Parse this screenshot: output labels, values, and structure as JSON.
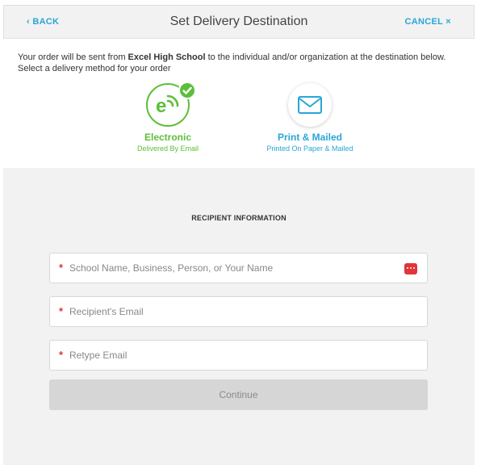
{
  "header": {
    "back_label": "‹ BACK",
    "title": "Set Delivery Destination",
    "cancel_label": "CANCEL ×"
  },
  "intro": {
    "prefix": "Your order will be sent from ",
    "school": "Excel High School",
    "suffix": " to the individual and/or organization at the destination below. Select a delivery method for your order"
  },
  "delivery_methods": [
    {
      "label": "Electronic",
      "sublabel": "Delivered By Email",
      "selected": true,
      "icon": "e-delivery-icon",
      "color": "#5cbf3a"
    },
    {
      "label": "Print & Mailed",
      "sublabel": "Printed On Paper & Mailed",
      "selected": false,
      "icon": "envelope-icon",
      "color": "#2aa6d6"
    }
  ],
  "form": {
    "section_title": "RECIPIENT INFORMATION",
    "required_marker": "*",
    "fields": [
      {
        "placeholder": "School Name, Business, Person, or Your Name",
        "value": ""
      },
      {
        "placeholder": "Recipient's Email",
        "value": ""
      },
      {
        "placeholder": "Retype Email",
        "value": ""
      }
    ],
    "continue_label": "Continue"
  },
  "colors": {
    "accent_blue": "#2aa6d6",
    "accent_green": "#5cbf3a",
    "required_red": "#e0353a",
    "panel_gray": "#f2f2f2"
  }
}
